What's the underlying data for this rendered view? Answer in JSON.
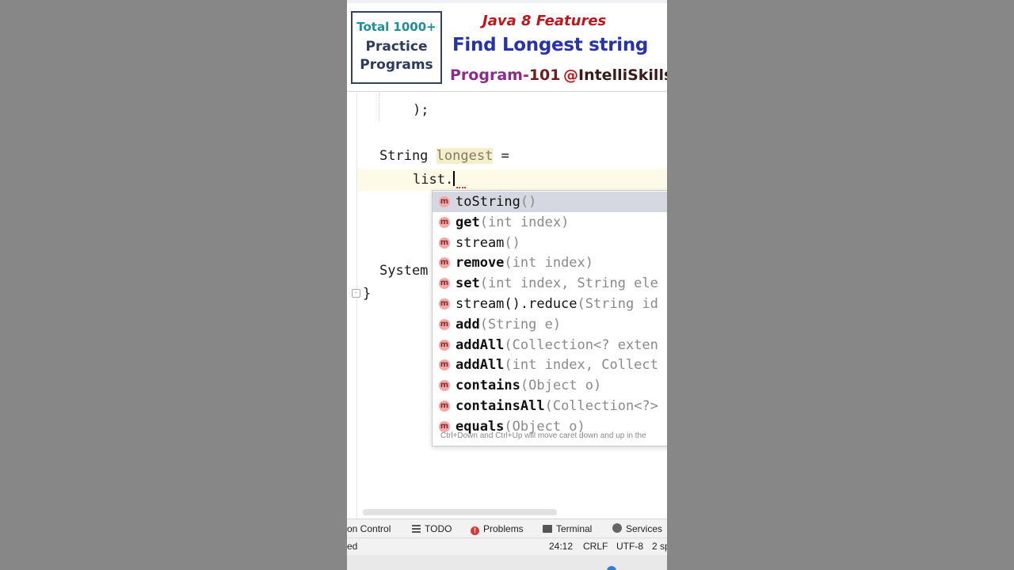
{
  "banner": {
    "badge_total": "Total 1000+",
    "badge_practice": "Practice",
    "badge_programs": "Programs",
    "subtitle": "Java 8 Features",
    "title": "Find Longest string",
    "program_label": "Program-",
    "program_number": "101",
    "handle_at": "@",
    "handle_name": "IntelliSkills",
    "colors": {
      "title": "#2733a6",
      "subtitle": "#c0161b",
      "badge_accent": "#1f8f97",
      "program": "#8b2b8c"
    }
  },
  "editor": {
    "line_close": ");",
    "line_decl_type": "String ",
    "line_decl_var": "longest",
    "line_decl_eq": " =",
    "line_call": "list.",
    "line_system": "System",
    "line_brace": "}"
  },
  "completion": {
    "icon_letter": "m",
    "items": [
      {
        "name": "toString",
        "sig": "()",
        "bold": false
      },
      {
        "name": "get",
        "sig": "(int index)",
        "bold": true
      },
      {
        "name": "stream",
        "sig": "()",
        "bold": false
      },
      {
        "name": "remove",
        "sig": "(int index)",
        "bold": true
      },
      {
        "name": "set",
        "sig": "(int index, String ele",
        "bold": true
      },
      {
        "name": "stream().reduce",
        "sig": "(String id",
        "bold": false
      },
      {
        "name": "add",
        "sig": "(String e)",
        "bold": true
      },
      {
        "name": "addAll",
        "sig": "(Collection<? exten",
        "bold": true
      },
      {
        "name": "addAll",
        "sig": "(int index, Collect",
        "bold": true
      },
      {
        "name": "contains",
        "sig": "(Object o)",
        "bold": true
      },
      {
        "name": "containsAll",
        "sig": "(Collection<?>",
        "bold": true
      },
      {
        "name": "equals",
        "sig": "(Object o)",
        "bold": true
      }
    ],
    "hint": "Ctrl+Down and Ctrl+Up will move caret down and up in the"
  },
  "toolwindows": {
    "version_control": "on Control",
    "todo": "TODO",
    "problems": "Problems",
    "terminal": "Terminal",
    "services": "Services"
  },
  "status": {
    "message": "ed",
    "position": "24:12",
    "line_ending": "CRLF",
    "encoding": "UTF-8",
    "indent": "2 sp"
  }
}
